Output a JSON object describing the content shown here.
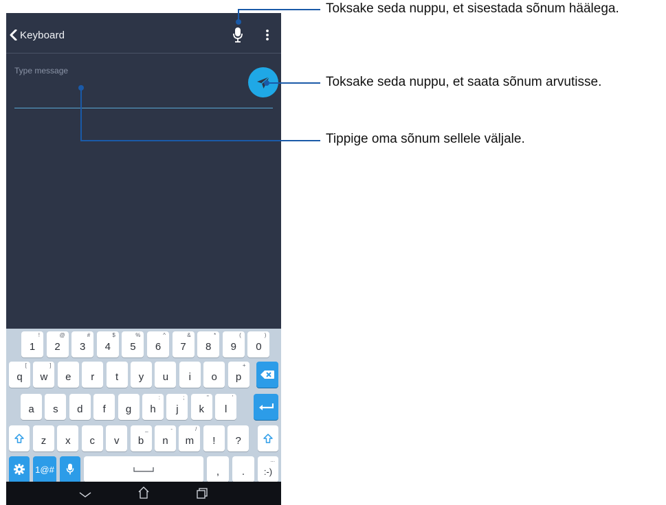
{
  "appbar": {
    "back_label": "Keyboard",
    "mic_icon": "microphone-icon",
    "overflow_icon": "more-vertical-icon"
  },
  "message": {
    "placeholder": "Type message",
    "value": "",
    "send_icon": "paper-plane-icon"
  },
  "keyboard": {
    "number_row": [
      {
        "key": "1",
        "sup": "!"
      },
      {
        "key": "2",
        "sup": "@"
      },
      {
        "key": "3",
        "sup": "#"
      },
      {
        "key": "4",
        "sup": "$"
      },
      {
        "key": "5",
        "sup": "%"
      },
      {
        "key": "6",
        "sup": "^"
      },
      {
        "key": "7",
        "sup": "&"
      },
      {
        "key": "8",
        "sup": "*"
      },
      {
        "key": "9",
        "sup": "("
      },
      {
        "key": "0",
        "sup": ")"
      }
    ],
    "row1": [
      {
        "key": "q",
        "sup": "["
      },
      {
        "key": "w",
        "sup": "]"
      },
      {
        "key": "e",
        "sup": ""
      },
      {
        "key": "r",
        "sup": ""
      },
      {
        "key": "t",
        "sup": ""
      },
      {
        "key": "y",
        "sup": ""
      },
      {
        "key": "u",
        "sup": ""
      },
      {
        "key": "i",
        "sup": ""
      },
      {
        "key": "o",
        "sup": ""
      },
      {
        "key": "p",
        "sup": "+"
      }
    ],
    "row2": [
      {
        "key": "a",
        "sup": ""
      },
      {
        "key": "s",
        "sup": ""
      },
      {
        "key": "d",
        "sup": ""
      },
      {
        "key": "f",
        "sup": ""
      },
      {
        "key": "g",
        "sup": ""
      },
      {
        "key": "h",
        "sup": ":"
      },
      {
        "key": "j",
        "sup": ";"
      },
      {
        "key": "k",
        "sup": "\""
      },
      {
        "key": "l",
        "sup": "'"
      }
    ],
    "row3": [
      {
        "key": "z",
        "sup": ""
      },
      {
        "key": "x",
        "sup": ""
      },
      {
        "key": "c",
        "sup": ""
      },
      {
        "key": "v",
        "sup": ""
      },
      {
        "key": "b",
        "sup": "_"
      },
      {
        "key": "n",
        "sup": "-"
      },
      {
        "key": "m",
        "sup": "/"
      },
      {
        "key": "!",
        "sup": ""
      },
      {
        "key": "?",
        "sup": ""
      }
    ],
    "symbols_key": "1@#",
    "comma_key": ",",
    "period_key": ".",
    "smiley_key": ":-)",
    "smiley_sup": "...",
    "backspace_icon": "backspace-icon",
    "enter_icon": "enter-icon",
    "shift_icon": "shift-icon",
    "settings_icon": "gear-icon",
    "voice_icon": "microphone-icon",
    "space_icon": "space-bar-icon",
    "accent_color": "#2c9ce8",
    "background_color": "#c3d0dd"
  },
  "navbar": {
    "back_icon": "nav-back-icon",
    "home_icon": "nav-home-icon",
    "recents_icon": "nav-recents-icon"
  },
  "callouts": {
    "voice": "Toksake seda nuppu, et sisestada sõnum häälega.",
    "send": "Toksake seda nuppu, et saata sõnum arvutisse.",
    "type": "Tippige oma sõnum sellele väljale.",
    "line_color": "#1a5aa8"
  },
  "colors": {
    "app_background": "#2d3547",
    "send_button": "#1fa8e6",
    "input_underline": "#5aa9d6"
  }
}
